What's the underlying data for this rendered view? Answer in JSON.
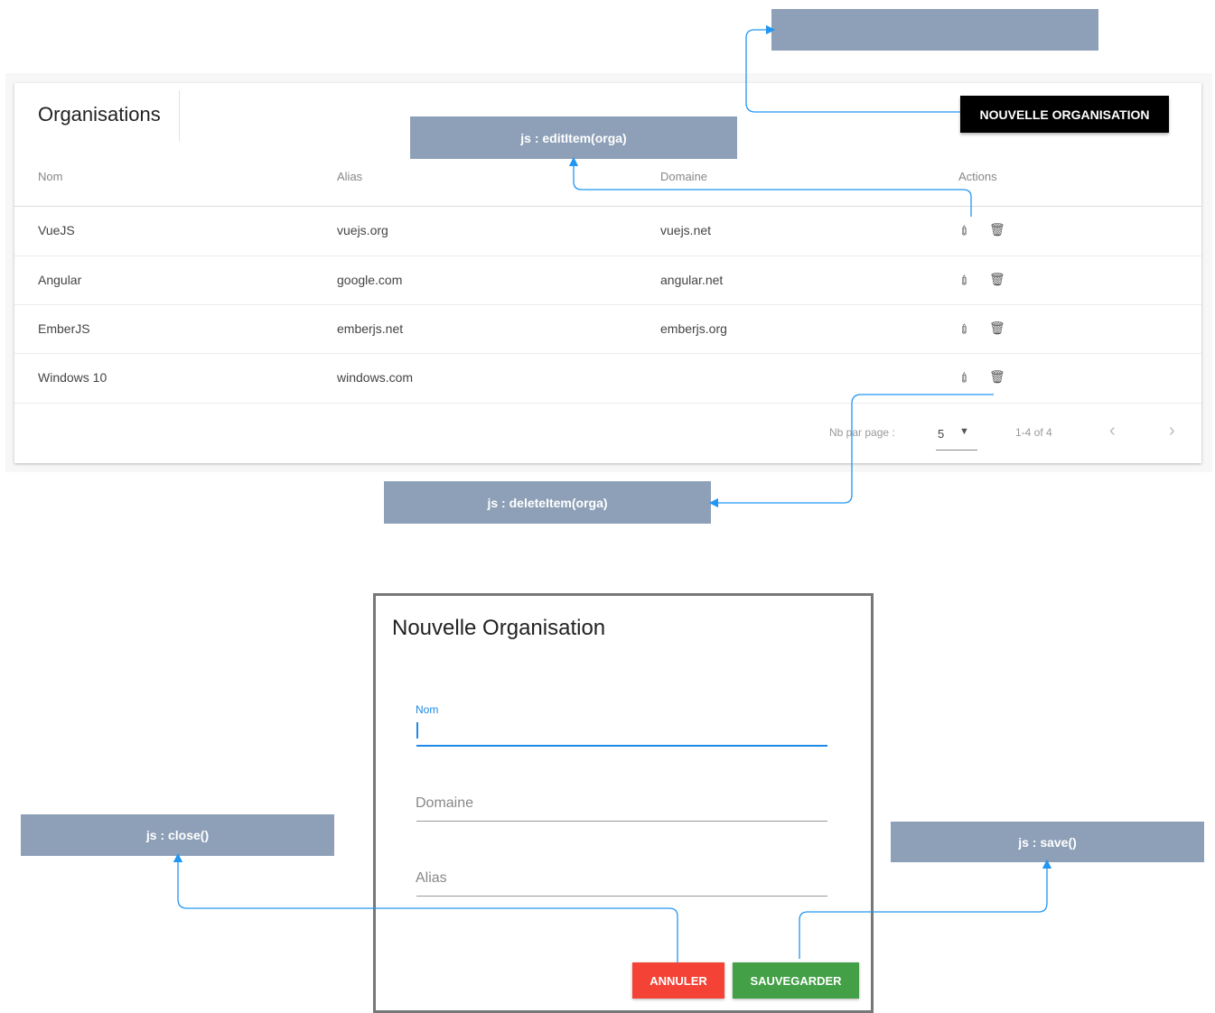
{
  "page": {
    "title": "Organisations",
    "new_button": "NOUVELLE ORGANISATION"
  },
  "table": {
    "columns": [
      "Nom",
      "Alias",
      "Domaine",
      "Actions"
    ],
    "rows": [
      {
        "nom": "VueJS",
        "alias": "vuejs.org",
        "domaine": "vuejs.net"
      },
      {
        "nom": "Angular",
        "alias": "google.com",
        "domaine": "angular.net"
      },
      {
        "nom": "EmberJS",
        "alias": "emberjs.net",
        "domaine": "emberjs.org"
      },
      {
        "nom": "Windows 10",
        "alias": "windows.com",
        "domaine": ""
      }
    ]
  },
  "pagination": {
    "per_page_label": "Nb par page :",
    "per_page_value": "5",
    "range": "1-4 of 4"
  },
  "annotations": {
    "edit": "js : editItem(orga)",
    "delete": "js : deleteItem(orga)",
    "close": "js : close()",
    "save": "js : save()"
  },
  "dialog": {
    "title": "Nouvelle Organisation",
    "fields": {
      "nom_label": "Nom",
      "domaine_placeholder": "Domaine",
      "alias_placeholder": "Alias"
    },
    "cancel": "ANNULER",
    "save": "SAUVEGARDER"
  },
  "colors": {
    "annotation": "#8ea0b7",
    "connector": "#2196f3",
    "cancel": "#f44336",
    "save": "#43a047",
    "focus": "#1e88e5"
  },
  "icons": {
    "edit": "pencil-icon",
    "delete": "trash-icon",
    "dropdown": "caret-down-icon",
    "prev": "chevron-left-icon",
    "next": "chevron-right-icon"
  }
}
